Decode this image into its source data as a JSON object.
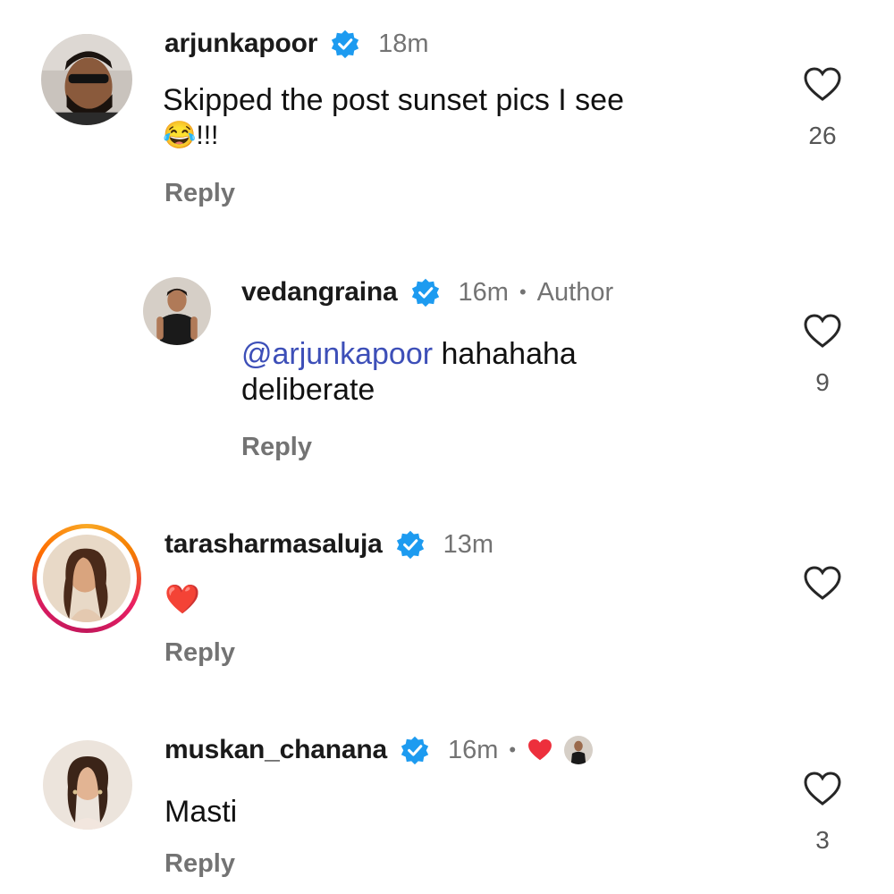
{
  "comments": [
    {
      "username": "arjunkapoor",
      "time": "18m",
      "text_line1": "Skipped the post sunset pics I see",
      "text_line2": "😂!!!",
      "reply_label": "Reply",
      "likes": "26"
    },
    {
      "username": "vedangraina",
      "time": "16m",
      "separator": "•",
      "author_label": "Author",
      "mention": "@arjunkapoor",
      "text_rest": " hahahaha",
      "text_line2": "deliberate",
      "reply_label": "Reply",
      "likes": "9"
    },
    {
      "username": "tarasharmasaluja",
      "time": "13m",
      "text": "❤️",
      "reply_label": "Reply",
      "likes": ""
    },
    {
      "username": "muskan_chanana",
      "time": "16m",
      "separator": "•",
      "text": "Masti",
      "reply_label": "Reply",
      "likes": "3"
    }
  ],
  "colors": {
    "verified": "#1d9bf0",
    "mention": "#3d4fb8",
    "secondary_text": "#737373",
    "heart_red": "#ed2f3c"
  }
}
